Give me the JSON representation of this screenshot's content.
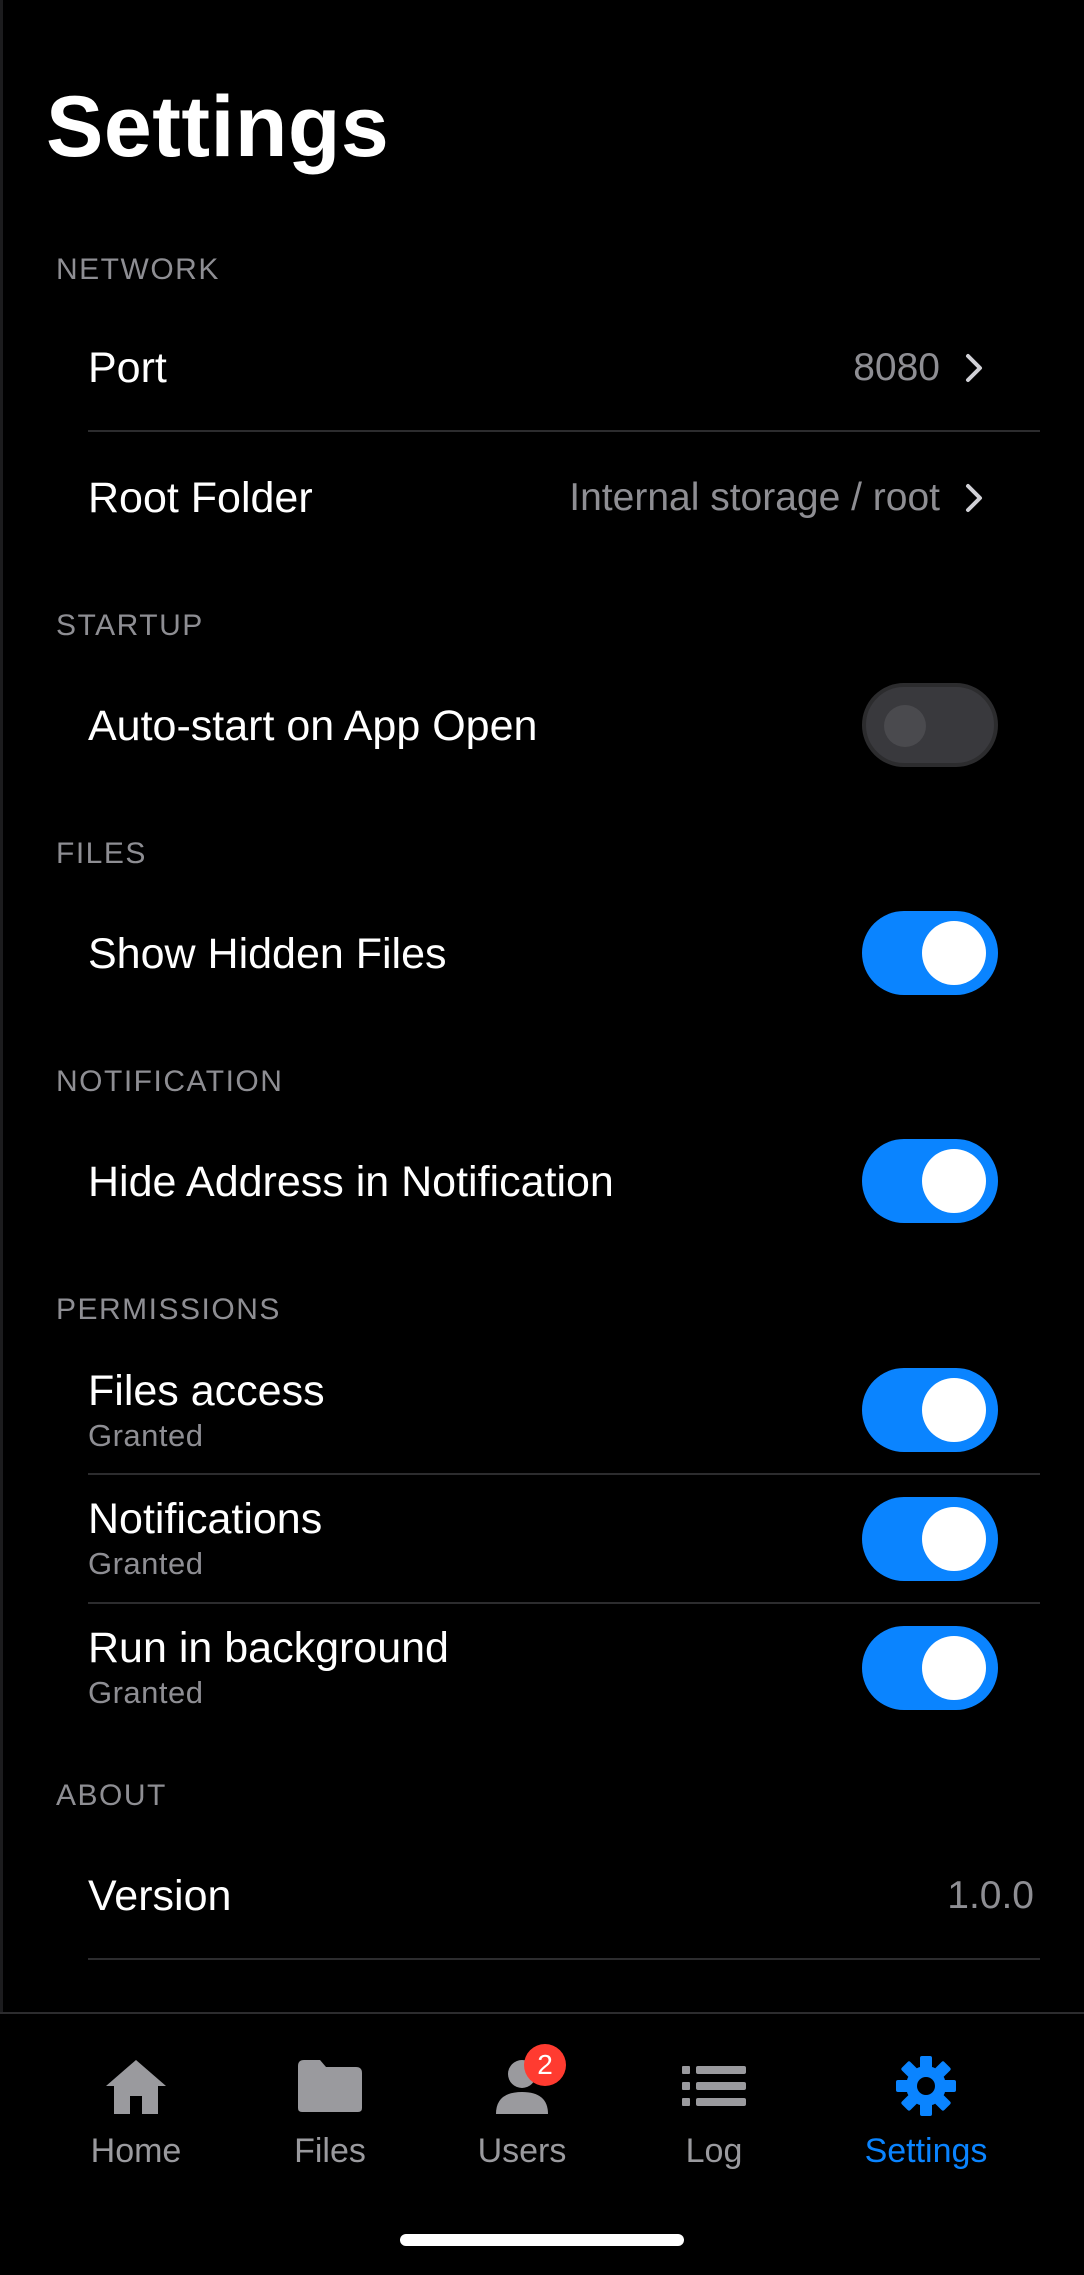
{
  "page": {
    "title": "Settings"
  },
  "colors": {
    "accent": "#0a84ff",
    "background": "#000000",
    "secondary_text": "#8e8e93",
    "badge": "#ff3b30"
  },
  "sections": {
    "network": {
      "header": "NETWORK",
      "port": {
        "label": "Port",
        "value": "8080"
      },
      "root_folder": {
        "label": "Root Folder",
        "value": "Internal storage / root"
      }
    },
    "startup": {
      "header": "STARTUP",
      "auto_start": {
        "label": "Auto-start on App Open",
        "enabled": false
      }
    },
    "files": {
      "header": "FILES",
      "show_hidden": {
        "label": "Show Hidden Files",
        "enabled": true
      }
    },
    "notification": {
      "header": "NOTIFICATION",
      "hide_address": {
        "label": "Hide Address in Notification",
        "enabled": true
      }
    },
    "permissions": {
      "header": "PERMISSIONS",
      "items": [
        {
          "label": "Files access",
          "status": "Granted",
          "enabled": true
        },
        {
          "label": "Notifications",
          "status": "Granted",
          "enabled": true
        },
        {
          "label": "Run in background",
          "status": "Granted",
          "enabled": true
        }
      ]
    },
    "about": {
      "header": "ABOUT",
      "version": {
        "label": "Version",
        "value": "1.0.0"
      }
    }
  },
  "tabbar": {
    "tabs": [
      {
        "label": "Home",
        "icon": "home-icon",
        "active": false
      },
      {
        "label": "Files",
        "icon": "folder-icon",
        "active": false
      },
      {
        "label": "Users",
        "icon": "user-icon",
        "active": false,
        "badge": "2"
      },
      {
        "label": "Log",
        "icon": "list-icon",
        "active": false
      },
      {
        "label": "Settings",
        "icon": "gear-icon",
        "active": true
      }
    ]
  }
}
